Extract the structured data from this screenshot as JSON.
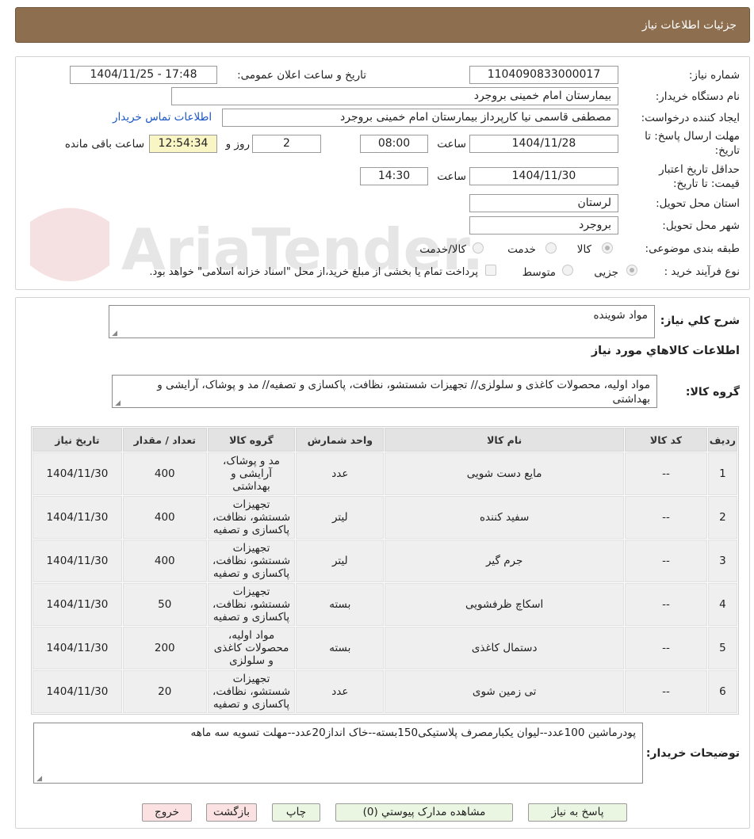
{
  "header": {
    "title": "جزئیات اطلاعات نیاز"
  },
  "info": {
    "need_number_label": "شماره نیاز:",
    "need_number": "1104090833000017",
    "announce_label": "تاریخ و ساعت اعلان عمومی:",
    "announce_value": "1404/11/25 - 17:48",
    "buyer_org_label": "نام دستگاه خریدار:",
    "buyer_org": "بیمارستان امام خمینی بروجرد",
    "requester_label": "ایجاد کننده درخواست:",
    "requester": "مصطفی  قاسمی نیا کارپرداز بیمارستان امام خمینی بروجرد",
    "contact_link": "اطلاعات تماس خریدار",
    "deadline_label_1": "مهلت ارسال پاسخ: تا",
    "deadline_label_2": "تاریخ:",
    "deadline_date": "1404/11/28",
    "time_label": "ساعت",
    "deadline_time": "08:00",
    "days_value": "2",
    "days_label": "روز و",
    "remaining_time": "12:54:34",
    "remaining_label": "ساعت باقی مانده",
    "validity_label_1": "حداقل تاریخ اعتبار",
    "validity_label_2": "قیمت: تا تاریخ:",
    "validity_date": "1404/11/30",
    "validity_time": "14:30",
    "province_label": "استان محل تحویل:",
    "province": "لرستان",
    "city_label": "شهر محل تحویل:",
    "city": "بروجرد",
    "category_label": "طبقه بندی موضوعی:",
    "category_options": [
      "کالا",
      "خدمت",
      "کالا/خدمت"
    ],
    "category_selected": "کالا",
    "process_label": "نوع فرآیند خرید :",
    "process_options": [
      "جزیی",
      "متوسط"
    ],
    "process_selected": "جزیی",
    "payment_note": "پرداخت تمام یا بخشی از مبلغ خرید،از محل \"اسناد خزانه اسلامی\" خواهد بود."
  },
  "watermark": {
    "text": "AriaTender.net"
  },
  "details": {
    "general_desc_label": "شرح کلي نياز:",
    "general_desc": "مواد شوینده",
    "goods_info_title": "اطلاعات کالاهاي مورد نياز",
    "goods_group_label": "گروه کالا:",
    "goods_group": "مواد اولیه، محصولات کاغذی و سلولزی// تجهیزات شستشو، نظافت، پاکسازی و تصفیه// مد و پوشاک، آرایشی و بهداشتی"
  },
  "table": {
    "headers": [
      "ردیف",
      "کد کالا",
      "نام کالا",
      "واحد شمارش",
      "گروه کالا",
      "تعداد / مقدار",
      "تاریخ نیاز"
    ],
    "rows": [
      [
        "1",
        "--",
        "مایع دست شویی",
        "عدد",
        "مد و پوشاک، آرایشی و بهداشتی",
        "400",
        "1404/11/30"
      ],
      [
        "2",
        "--",
        "سفید کننده",
        "لیتر",
        "تجهیزات شستشو، نظافت، پاکسازی و تصفیه",
        "400",
        "1404/11/30"
      ],
      [
        "3",
        "--",
        "جرم گیر",
        "لیتر",
        "تجهیزات شستشو، نظافت، پاکسازی و تصفیه",
        "400",
        "1404/11/30"
      ],
      [
        "4",
        "--",
        "اسکاچ ظرفشویی",
        "بسته",
        "تجهیزات شستشو، نظافت، پاکسازی و تصفیه",
        "50",
        "1404/11/30"
      ],
      [
        "5",
        "--",
        "دستمال کاغذی",
        "بسته",
        "مواد اولیه، محصولات کاغذی و سلولزی",
        "200",
        "1404/11/30"
      ],
      [
        "6",
        "--",
        "تی زمین شوی",
        "عدد",
        "تجهیزات شستشو، نظافت، پاکسازی و تصفیه",
        "20",
        "1404/11/30"
      ]
    ]
  },
  "buyer_notes": {
    "label": "توضیحات خریدار:",
    "text": "پودرماشین 100عدد--لیوان یکبارمصرف پلاستیکی150بسته--خاک انداز20عدد--مهلت تسویه سه ماهه"
  },
  "buttons": {
    "reply": "پاسخ به نياز",
    "attachments": "مشاهده مدارک پيوستي (0)",
    "print": "چاپ",
    "back": "بازگشت",
    "exit": "خروج"
  }
}
